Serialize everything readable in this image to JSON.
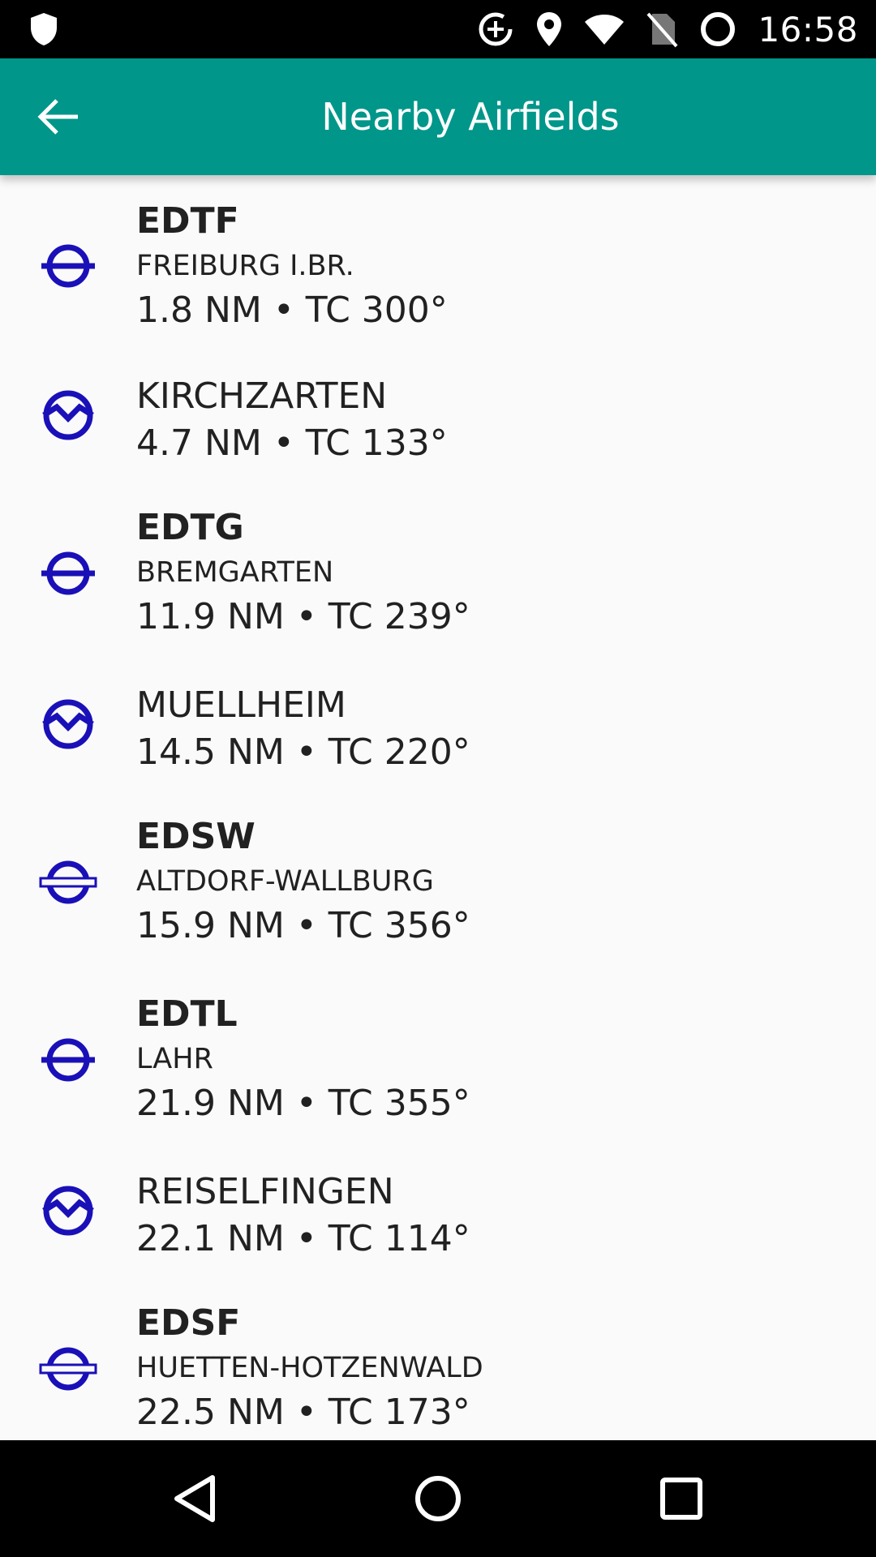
{
  "status_bar": {
    "time": "16:58",
    "icons": [
      "shield-icon",
      "data-saver-icon",
      "location-icon",
      "wifi-icon",
      "no-sim-icon",
      "battery-charging-icon"
    ]
  },
  "app_bar": {
    "title": "Nearby Airfields",
    "back_icon": "arrow-back-icon"
  },
  "colors": {
    "app_bar": "#00968a",
    "icon_blue": "#1a10b8",
    "text": "#212121",
    "background": "#fafafa"
  },
  "airfields": [
    {
      "ident": "EDTF",
      "name": "FREIBURG I.BR.",
      "info": "1.8 NM • TC 300°",
      "icon": "airfield-icon"
    },
    {
      "ident": "",
      "name": "KIRCHZARTEN",
      "info": "4.7 NM • TC 133°",
      "icon": "glider-site-icon"
    },
    {
      "ident": "EDTG",
      "name": "BREMGARTEN",
      "info": "11.9 NM • TC 239°",
      "icon": "airfield-icon"
    },
    {
      "ident": "",
      "name": "MUELLHEIM",
      "info": "14.5 NM • TC 220°",
      "icon": "glider-site-icon"
    },
    {
      "ident": "EDSW",
      "name": "ALTDORF-WALLBURG",
      "info": "15.9 NM • TC 356°",
      "icon": "airfield-runway-icon"
    },
    {
      "ident": "EDTL",
      "name": "LAHR",
      "info": "21.9 NM • TC 355°",
      "icon": "airfield-icon"
    },
    {
      "ident": "",
      "name": "REISELFINGEN",
      "info": "22.1 NM • TC 114°",
      "icon": "glider-site-icon"
    },
    {
      "ident": "EDSF",
      "name": "HUETTEN-HOTZENWALD",
      "info": "22.5 NM • TC 173°",
      "icon": "airfield-runway-icon"
    }
  ],
  "nav_bar": {
    "back": "nav-back-icon",
    "home": "nav-home-icon",
    "recents": "nav-recents-icon"
  }
}
